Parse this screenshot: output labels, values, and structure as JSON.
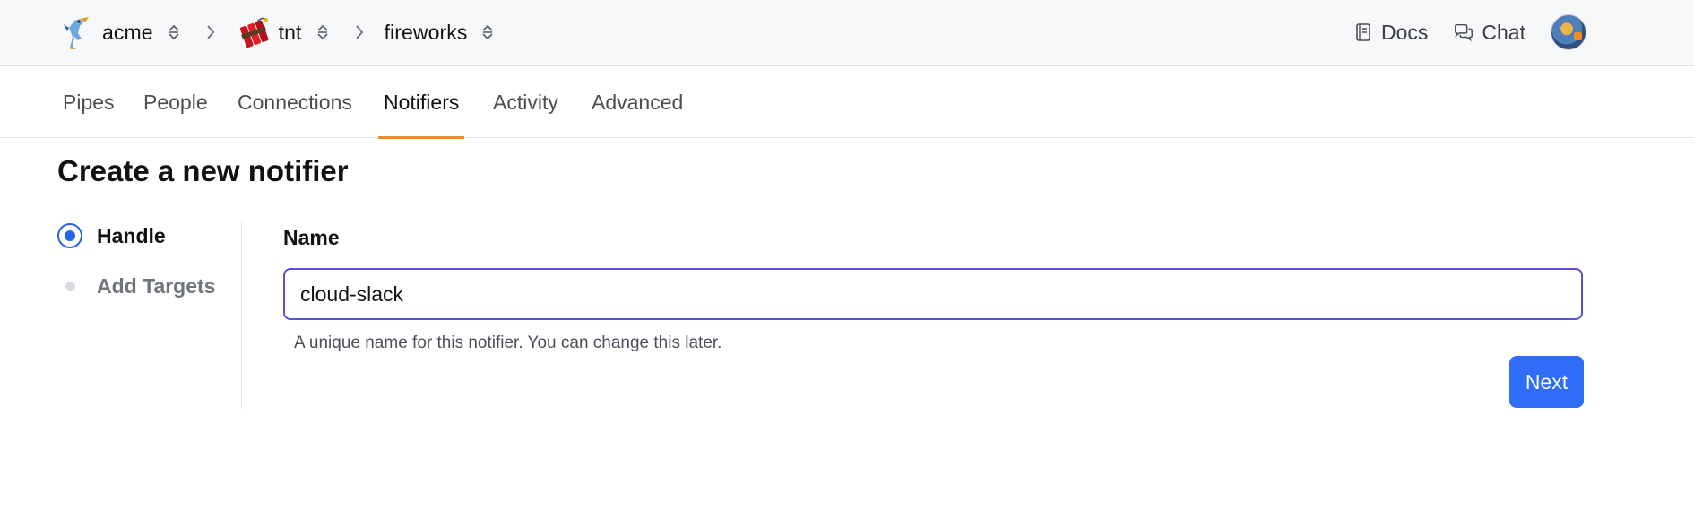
{
  "breadcrumbs": [
    {
      "label": "acme",
      "icon": "roadrunner-logo"
    },
    {
      "label": "tnt",
      "icon": "dynamite-logo"
    },
    {
      "label": "fireworks",
      "icon": null
    }
  ],
  "header": {
    "docs_label": "Docs",
    "chat_label": "Chat",
    "avatar_icon": "user-avatar"
  },
  "tabs": [
    {
      "label": "Pipes",
      "active": false
    },
    {
      "label": "People",
      "active": false
    },
    {
      "label": "Connections",
      "active": false
    },
    {
      "label": "Notifiers",
      "active": true
    },
    {
      "label": "Activity",
      "active": false
    },
    {
      "label": "Advanced",
      "active": false
    }
  ],
  "page": {
    "title": "Create a new notifier"
  },
  "steps": [
    {
      "label": "Handle",
      "state": "active"
    },
    {
      "label": "Add Targets",
      "state": "pending"
    }
  ],
  "form": {
    "name_label": "Name",
    "name_value": "cloud-slack",
    "name_hint": "A unique name for this notifier. You can change this later.",
    "next_label": "Next"
  },
  "colors": {
    "accent_tab": "#f08a24",
    "primary_button": "#2f6df6",
    "input_focus": "#5b4fd6",
    "step_active": "#2563eb"
  }
}
